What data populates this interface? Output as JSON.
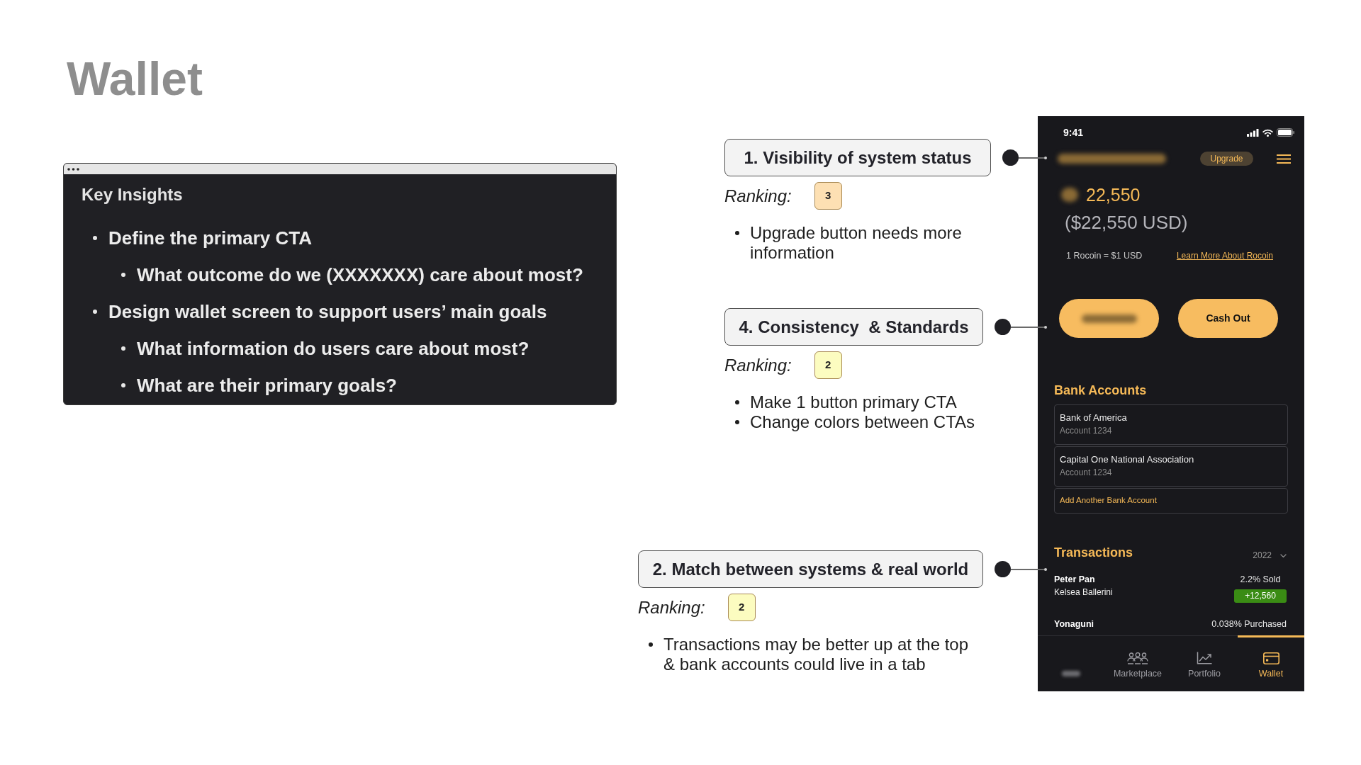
{
  "page_title": "Wallet",
  "insights_card": {
    "title": "Key Insights",
    "items": [
      {
        "text": "Define the primary CTA",
        "children": [
          {
            "text": "What outcome do we (XXXXXXX) care about most?"
          }
        ]
      },
      {
        "text": "Design wallet screen to support users’ main goals",
        "children": [
          {
            "text": "What information do users care about most?"
          },
          {
            "text": "What are their primary goals?"
          }
        ]
      }
    ]
  },
  "annotations": [
    {
      "heading": "1. Visibility of system status",
      "ranking_label": "Ranking:",
      "ranking": "3",
      "color": "#fde0b3",
      "notes": [
        "Upgrade button needs more information"
      ]
    },
    {
      "heading": "4. Consistency  & Standards",
      "ranking_label": "Ranking:",
      "ranking": "2",
      "color": "#fcfcc0",
      "notes": [
        "Make 1 button primary CTA",
        "Change colors between CTAs"
      ]
    },
    {
      "heading": "2. Match between systems & real world",
      "ranking_label": "Ranking:",
      "ranking": "2",
      "color": "#fcfcc0",
      "notes": [
        "Transactions may be better up at the top & bank accounts could live in a tab"
      ]
    }
  ],
  "phone": {
    "status_time": "9:41",
    "upgrade_label": "Upgrade",
    "balance": "22,550",
    "balance_usd": "($22,550 USD)",
    "rate": "1 Rocoin = $1 USD",
    "learn_more_link": "Learn More About Rocoin",
    "actions": [
      {
        "kind": "blurred"
      },
      {
        "kind": "labeled",
        "label": "Cash Out"
      }
    ],
    "bank_accounts": {
      "heading": "Bank Accounts",
      "accounts": [
        {
          "name": "Bank of America",
          "number": "Account 1234"
        },
        {
          "name": "Capital One National Association",
          "number": "Account 1234"
        }
      ],
      "add_label": "Add Another Bank Account"
    },
    "transactions": {
      "heading": "Transactions",
      "year": "2022",
      "rows": [
        {
          "title": "Peter Pan",
          "subtitle": "Kelsea Ballerini",
          "detail": "2.2% Sold",
          "amount": "+12,560"
        },
        {
          "title": "Yonaguni",
          "detail": "0.038% Purchased"
        }
      ]
    },
    "tabs": [
      {
        "kind": "blurred",
        "selected": false
      },
      {
        "kind": "labeled",
        "label": "Marketplace",
        "selected": false
      },
      {
        "kind": "labeled",
        "label": "Portfolio",
        "selected": false
      },
      {
        "kind": "labeled",
        "label": "Wallet",
        "selected": true
      }
    ]
  }
}
